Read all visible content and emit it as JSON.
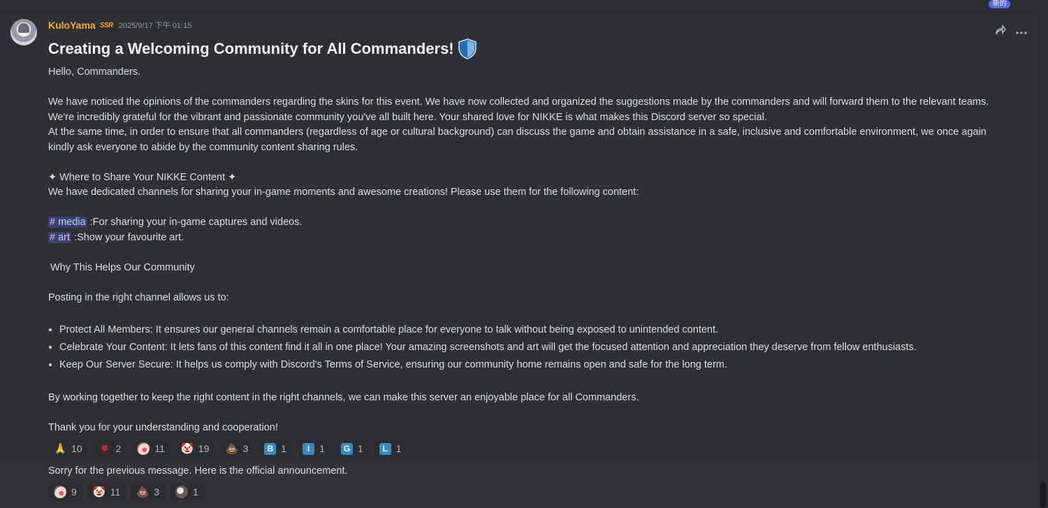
{
  "new_pill": "新的",
  "message": {
    "username": "KuloYama",
    "user_badge": "SSR",
    "timestamp": "2025/9/17 下午 01:15",
    "title": "Creating a Welcoming Community for All Commanders!",
    "title_emoji": "shield-icon",
    "paragraphs": [
      "Hello, Commanders.",
      "We have noticed the opinions of the commanders regarding the skins for this event. We have now collected and organized the suggestions made by the commanders and will forward them to the relevant teams.",
      "We're incredibly grateful for the vibrant and passionate community you've all built here. Your shared love for NIKKE is what makes this Discord server so special.",
      "At the same time, in order to ensure that all commanders (regardless of age or cultural background) can discuss the game and obtain assistance in a safe, inclusive and comfortable environment, we once again",
      "kindly ask everyone to abide by the community content sharing rules.",
      "✦ Where to Share Your NIKKE Content ✦",
      "We have dedicated channels for sharing your in-game moments and awesome creations! Please use them for the following content:"
    ],
    "channels": [
      {
        "name": "# media",
        "text": ":For sharing your in-game captures and videos."
      },
      {
        "name": "# art",
        "text": ":Show your favourite art."
      }
    ],
    "why_heading": "Why This Helps Our Community",
    "posting_line": "Posting in the right channel allows us to:",
    "bullets": [
      "Protect All Members: It ensures our general channels remain a comfortable place for everyone to talk without being exposed to unintended content.",
      "Celebrate Your Content: It lets fans of this content find it all in one place! Your amazing screenshots and art will get the focused attention and appreciation they deserve from fellow enthusiasts.",
      "Keep Our Server Secure: It helps us comply with Discord's Terms of Service, ensuring our community home remains open and safe for the long term."
    ],
    "closing_1": "By working together to keep the right content in the right channels, we can make this server an enjoyable place for all Commanders.",
    "closing_2": "Thank you for your understanding and cooperation!",
    "reactions": [
      {
        "emoji": "🙏",
        "count": "10",
        "icon": "folded-hands-icon"
      },
      {
        "emoji": "",
        "count": "2",
        "icon": "custom-avatar-emoji-icon"
      },
      {
        "emoji": "",
        "count": "11",
        "icon": "custom-anime-emoji-icon"
      },
      {
        "emoji": "🤡",
        "count": "19",
        "icon": "clown-icon"
      },
      {
        "emoji": "💩",
        "count": "3",
        "icon": "poop-icon"
      },
      {
        "emoji": "B",
        "count": "1",
        "icon": "regional-b-icon"
      },
      {
        "emoji": "I",
        "count": "1",
        "icon": "regional-i-icon"
      },
      {
        "emoji": "G",
        "count": "1",
        "icon": "regional-g-icon"
      },
      {
        "emoji": "L",
        "count": "1",
        "icon": "regional-l-icon"
      }
    ]
  },
  "followup": {
    "text": "Sorry for the previous message. Here is the official announcement.",
    "reactions": [
      {
        "emoji": "",
        "count": "9",
        "icon": "custom-anime-emoji-icon"
      },
      {
        "emoji": "🤡",
        "count": "11",
        "icon": "clown-icon"
      },
      {
        "emoji": "💩",
        "count": "3",
        "icon": "poop-icon"
      },
      {
        "emoji": "",
        "count": "1",
        "icon": "custom-character-emoji-icon"
      }
    ]
  }
}
